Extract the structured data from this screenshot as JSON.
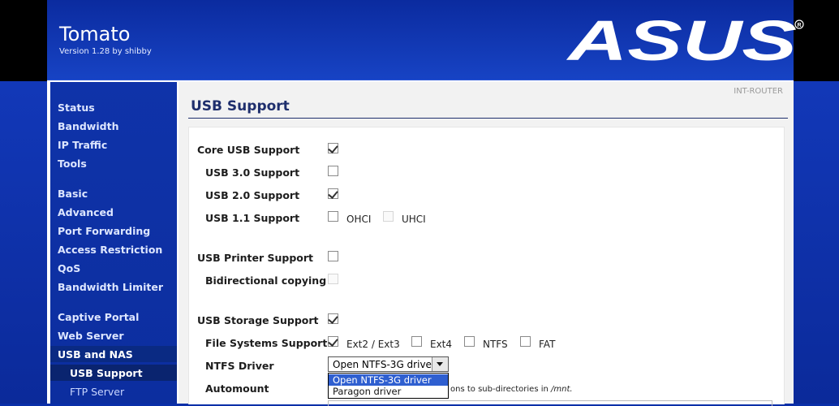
{
  "header": {
    "title": "Tomato",
    "version": "Version 1.28 by shibby",
    "logo_text": "ASUS"
  },
  "router_name": "INT-ROUTER",
  "sidebar": {
    "items": [
      {
        "label": "Status"
      },
      {
        "label": "Bandwidth"
      },
      {
        "label": "IP Traffic"
      },
      {
        "label": "Tools"
      },
      {
        "label": "Basic"
      },
      {
        "label": "Advanced"
      },
      {
        "label": "Port Forwarding"
      },
      {
        "label": "Access Restriction"
      },
      {
        "label": "QoS"
      },
      {
        "label": "Bandwidth Limiter"
      },
      {
        "label": "Captive Portal"
      },
      {
        "label": "Web Server"
      },
      {
        "label": "USB and NAS"
      },
      {
        "label": "USB Support"
      },
      {
        "label": "FTP Server"
      }
    ]
  },
  "page": {
    "title": "USB Support"
  },
  "form": {
    "core_usb": {
      "label": "Core USB Support",
      "checked": true
    },
    "usb3": {
      "label": "USB 3.0 Support",
      "checked": false
    },
    "usb2": {
      "label": "USB 2.0 Support",
      "checked": true
    },
    "usb1": {
      "label": "USB 1.1 Support",
      "ohci_label": "OHCI",
      "uhci_label": "UHCI"
    },
    "printer": {
      "label": "USB Printer Support",
      "checked": false
    },
    "bidirectional": {
      "label": "Bidirectional copying"
    },
    "storage": {
      "label": "USB Storage Support",
      "checked": true
    },
    "fs": {
      "label": "File Systems Support",
      "ext2_3": "Ext2 / Ext3",
      "ext4": "Ext4",
      "ntfs": "NTFS",
      "fat": "FAT"
    },
    "ntfs_driver": {
      "label": "NTFS Driver",
      "selected": "Open NTFS-3G driver",
      "options": [
        "Open NTFS-3G driver",
        "Paragon driver"
      ]
    },
    "automount": {
      "label": "Automount",
      "note_text": "ons to sub-directories in ",
      "note_path": "/mnt."
    }
  },
  "colors": {
    "header_bg": "#1743c4",
    "sidebar_bg": "#0f33a9",
    "title_color": "#1f2f6d",
    "dropdown_highlight": "#2f5fd0"
  }
}
